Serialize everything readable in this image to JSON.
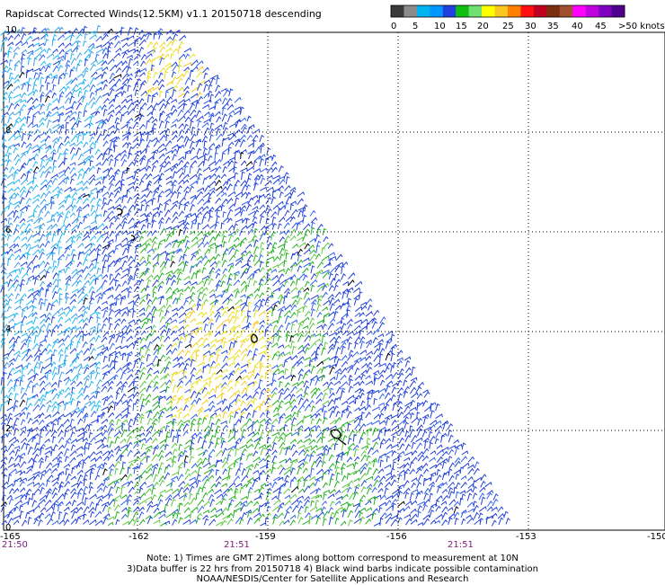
{
  "title": "Rapidscat Corrected Winds(12.5KM) v1.1 20150718 descending",
  "legend": {
    "colors": [
      "#3a3a3a",
      "#8c8c8c",
      "#00b4f0",
      "#0096ff",
      "#2040e0",
      "#10c010",
      "#70e070",
      "#ffff00",
      "#f8c820",
      "#ff8000",
      "#ff1010",
      "#c00020",
      "#7a3010",
      "#a05030",
      "#ff00ff",
      "#c000e0",
      "#8000c0",
      "#50008c"
    ],
    "labels": [
      "0",
      "5",
      "10",
      "15",
      "20",
      "25",
      "30",
      "35",
      "40",
      "45",
      ">50 knots"
    ]
  },
  "axes": {
    "x_labels": [
      "-165",
      "-162",
      "-159",
      "-156",
      "-153",
      "-150"
    ],
    "y_labels": [
      "10",
      "8",
      "6",
      "4",
      "2",
      "0"
    ],
    "time_labels": [
      "21:50",
      "21:51",
      "21:51"
    ]
  },
  "notes": [
    "Note: 1) Times are GMT 2)Times along bottom correspond to measurement at 10N",
    "3)Data buffer is 22 hrs from 20150718 4) Black wind barbs indicate possible contamination",
    "NOAA/NESDIS/Center for Satellite Applications and Research"
  ]
}
